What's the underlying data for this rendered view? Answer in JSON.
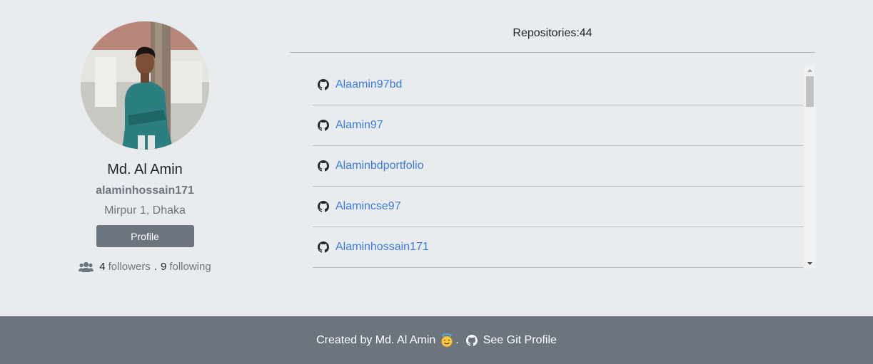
{
  "profile": {
    "name": "Md. Al Amin",
    "login": "alaminhossain171",
    "location": "Mirpur 1, Dhaka",
    "button_label": "Profile",
    "followers_count": "4",
    "followers_label": "followers",
    "separator": ".",
    "following_count": "9",
    "following_label": "following",
    "followers_icon": "users-icon"
  },
  "repos": {
    "title": "Repositories:44",
    "items": [
      {
        "name": "Alaamin97bd",
        "icon": "github-icon"
      },
      {
        "name": "Alamin97",
        "icon": "github-icon"
      },
      {
        "name": "Alaminbdportfolio",
        "icon": "github-icon"
      },
      {
        "name": "Alamincse97",
        "icon": "github-icon"
      },
      {
        "name": "Alaminhossain171",
        "icon": "github-icon"
      }
    ]
  },
  "footer": {
    "credit": "Created by Md. Al Amin",
    "emoji": "smiling-face-with-halo",
    "dot": ".",
    "link_label": "See Git Profile",
    "link_icon": "github-icon"
  },
  "colors": {
    "background": "#e9ecef",
    "footer": "#6c757d",
    "link": "#3b7be0",
    "button": "#6c757d"
  }
}
